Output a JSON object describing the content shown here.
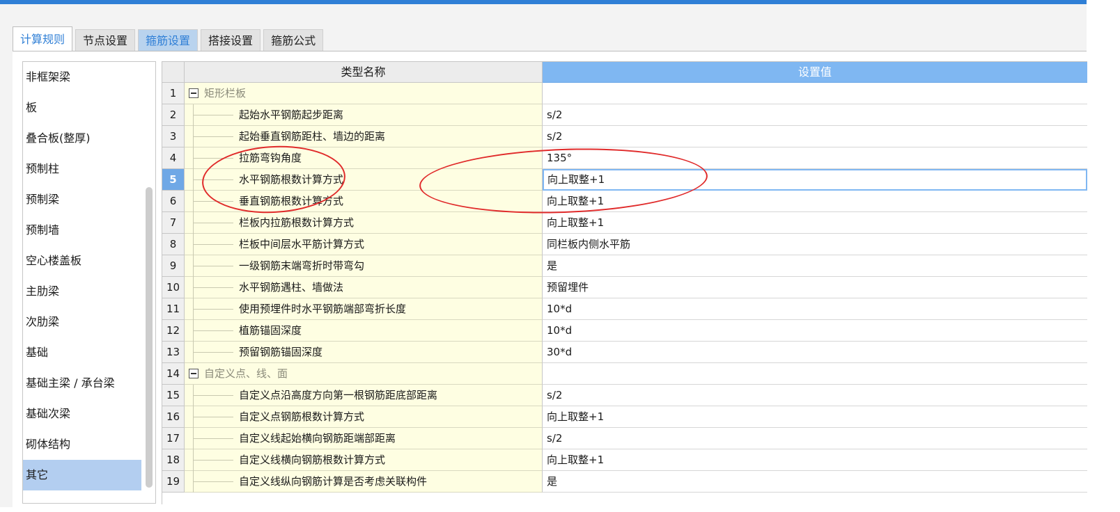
{
  "tabs": [
    {
      "label": "计算规则",
      "state": "active"
    },
    {
      "label": "节点设置",
      "state": "normal"
    },
    {
      "label": "箍筋设置",
      "state": "highlight"
    },
    {
      "label": "搭接设置",
      "state": "normal"
    },
    {
      "label": "箍筋公式",
      "state": "normal"
    }
  ],
  "sidebar": {
    "selected_index": 13,
    "items": [
      {
        "label": "非框架梁"
      },
      {
        "label": "板"
      },
      {
        "label": "叠合板(整厚)"
      },
      {
        "label": "预制柱"
      },
      {
        "label": "预制梁"
      },
      {
        "label": "预制墙"
      },
      {
        "label": "空心楼盖板"
      },
      {
        "label": "主肋梁"
      },
      {
        "label": "次肋梁"
      },
      {
        "label": "基础"
      },
      {
        "label": "基础主梁 / 承台梁"
      },
      {
        "label": "基础次梁"
      },
      {
        "label": "砌体结构"
      },
      {
        "label": "其它"
      }
    ]
  },
  "grid": {
    "headers": {
      "name": "类型名称",
      "value": "设置值"
    },
    "selected_row": 5,
    "rows": [
      {
        "idx": "1",
        "name": "矩形栏板",
        "value": "",
        "group": true
      },
      {
        "idx": "2",
        "name": "起始水平钢筋起步距离",
        "value": "s/2"
      },
      {
        "idx": "3",
        "name": "起始垂直钢筋距柱、墙边的距离",
        "value": "s/2"
      },
      {
        "idx": "4",
        "name": "拉筋弯钩角度",
        "value": "135°"
      },
      {
        "idx": "5",
        "name": "水平钢筋根数计算方式",
        "value": "向上取整+1"
      },
      {
        "idx": "6",
        "name": "垂直钢筋根数计算方式",
        "value": "向上取整+1"
      },
      {
        "idx": "7",
        "name": "栏板内拉筋根数计算方式",
        "value": "向上取整+1"
      },
      {
        "idx": "8",
        "name": "栏板中间层水平筋计算方式",
        "value": "同栏板内侧水平筋"
      },
      {
        "idx": "9",
        "name": "一级钢筋末端弯折时带弯勾",
        "value": "是"
      },
      {
        "idx": "10",
        "name": "水平钢筋遇柱、墙做法",
        "value": "预留埋件"
      },
      {
        "idx": "11",
        "name": "使用预埋件时水平钢筋端部弯折长度",
        "value": "10*d"
      },
      {
        "idx": "12",
        "name": "植筋锚固深度",
        "value": "10*d"
      },
      {
        "idx": "13",
        "name": "预留钢筋锚固深度",
        "value": "30*d"
      },
      {
        "idx": "14",
        "name": "自定义点、线、面",
        "value": "",
        "group": true
      },
      {
        "idx": "15",
        "name": "自定义点沿高度方向第一根钢筋距底部距离",
        "value": "s/2"
      },
      {
        "idx": "16",
        "name": "自定义点钢筋根数计算方式",
        "value": "向上取整+1"
      },
      {
        "idx": "17",
        "name": "自定义线起始横向钢筋距端部距离",
        "value": "s/2"
      },
      {
        "idx": "18",
        "name": "自定义线横向钢筋根数计算方式",
        "value": "向上取整+1"
      },
      {
        "idx": "19",
        "name": "自定义线纵向钢筋计算是否考虑关联构件",
        "value": "是"
      }
    ]
  },
  "colors": {
    "accent": "#2f7fd6",
    "header_value_bg": "#7fb7f2",
    "name_cell_bg": "#fefee2",
    "sidebar_selected": "#b3cef0",
    "annotation": "#e02a2a"
  }
}
